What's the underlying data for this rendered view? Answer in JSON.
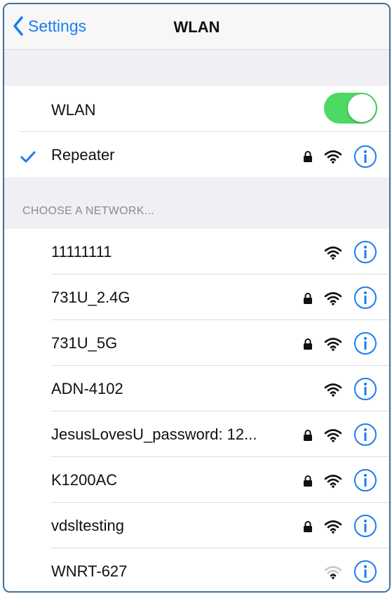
{
  "navbar": {
    "back_label": "Settings",
    "title": "WLAN"
  },
  "wlan_toggle": {
    "label": "WLAN",
    "state": "on",
    "on_color": "#4cd964"
  },
  "connected_network": {
    "name": "Repeater",
    "secured": true,
    "signal": "full"
  },
  "section": {
    "header": "CHOOSE A NETWORK..."
  },
  "networks": [
    {
      "name": "11111111",
      "secured": false,
      "signal": "full"
    },
    {
      "name": "731U_2.4G",
      "secured": true,
      "signal": "full"
    },
    {
      "name": "731U_5G",
      "secured": true,
      "signal": "full"
    },
    {
      "name": "ADN-4102",
      "secured": false,
      "signal": "full"
    },
    {
      "name": "JesusLovesU_password: 12...",
      "secured": true,
      "signal": "full"
    },
    {
      "name": "K1200AC",
      "secured": true,
      "signal": "full"
    },
    {
      "name": "vdsltesting",
      "secured": true,
      "signal": "full"
    },
    {
      "name": "WNRT-627",
      "secured": false,
      "signal": "weak"
    }
  ],
  "colors": {
    "accent": "#1a7cf2",
    "background": "#efeff4",
    "section_text": "#8a8a8f"
  },
  "icons": {
    "back": "chevron-left-icon",
    "check": "checkmark-icon",
    "lock": "lock-icon",
    "wifi": "wifi-icon",
    "info": "info-icon"
  }
}
